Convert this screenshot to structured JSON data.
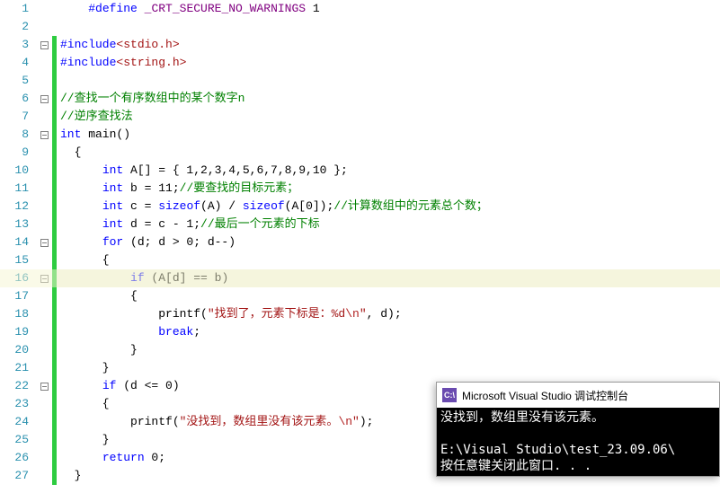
{
  "lines": [
    {
      "n": 1,
      "fold": "",
      "cb": "",
      "seg": [
        [
          "",
          "    "
        ],
        [
          "kw-blue",
          "#define"
        ],
        [
          "",
          " "
        ],
        [
          "kw-purple",
          "_CRT_SECURE_NO_WARNINGS"
        ],
        [
          "",
          " 1"
        ]
      ]
    },
    {
      "n": 2,
      "fold": "",
      "cb": "",
      "seg": []
    },
    {
      "n": 3,
      "fold": "−",
      "cb": "g",
      "seg": [
        [
          "kw-blue",
          "#include"
        ],
        [
          "str",
          "<stdio.h>"
        ]
      ]
    },
    {
      "n": 4,
      "fold": "",
      "cb": "g",
      "seg": [
        [
          "kw-blue",
          "#include"
        ],
        [
          "str",
          "<string.h>"
        ]
      ]
    },
    {
      "n": 5,
      "fold": "",
      "cb": "g",
      "seg": []
    },
    {
      "n": 6,
      "fold": "−",
      "cb": "g",
      "seg": [
        [
          "comment",
          "//查找一个有序数组中的某个数字n"
        ]
      ]
    },
    {
      "n": 7,
      "fold": "",
      "cb": "g",
      "seg": [
        [
          "comment",
          "//逆序查找法"
        ]
      ]
    },
    {
      "n": 8,
      "fold": "−",
      "cb": "g",
      "seg": [
        [
          "kw-blue",
          "int"
        ],
        [
          "",
          " main()"
        ]
      ]
    },
    {
      "n": 9,
      "fold": "",
      "cb": "g",
      "seg": [
        [
          "",
          "  {"
        ]
      ]
    },
    {
      "n": 10,
      "fold": "",
      "cb": "g",
      "seg": [
        [
          "",
          "      "
        ],
        [
          "kw-blue",
          "int"
        ],
        [
          "",
          " A[] = { 1,2,3,4,5,6,7,8,9,10 };"
        ]
      ]
    },
    {
      "n": 11,
      "fold": "",
      "cb": "g",
      "seg": [
        [
          "",
          "      "
        ],
        [
          "kw-blue",
          "int"
        ],
        [
          "",
          " b = 11;"
        ],
        [
          "comment",
          "//要查找的目标元素；"
        ]
      ]
    },
    {
      "n": 12,
      "fold": "",
      "cb": "g",
      "seg": [
        [
          "",
          "      "
        ],
        [
          "kw-blue",
          "int"
        ],
        [
          "",
          " c = "
        ],
        [
          "kw-blue",
          "sizeof"
        ],
        [
          "",
          "(A) / "
        ],
        [
          "kw-blue",
          "sizeof"
        ],
        [
          "",
          "(A[0]);"
        ],
        [
          "comment",
          "//计算数组中的元素总个数；"
        ]
      ]
    },
    {
      "n": 13,
      "fold": "",
      "cb": "g",
      "seg": [
        [
          "",
          "      "
        ],
        [
          "kw-blue",
          "int"
        ],
        [
          "",
          " d = c - 1;"
        ],
        [
          "comment",
          "//最后一个元素的下标"
        ]
      ]
    },
    {
      "n": 14,
      "fold": "−",
      "cb": "g",
      "seg": [
        [
          "",
          "      "
        ],
        [
          "kw-blue",
          "for"
        ],
        [
          "",
          " (d; d > 0; d--)"
        ]
      ]
    },
    {
      "n": 15,
      "fold": "",
      "cb": "g",
      "seg": [
        [
          "",
          "      {"
        ]
      ]
    },
    {
      "n": 16,
      "fold": "−",
      "cb": "g",
      "hl": true,
      "seg": [
        [
          "",
          "          "
        ],
        [
          "kw-blue",
          "if"
        ],
        [
          "",
          " (A[d] == b)"
        ]
      ]
    },
    {
      "n": 17,
      "fold": "",
      "cb": "g",
      "seg": [
        [
          "",
          "          {"
        ]
      ]
    },
    {
      "n": 18,
      "fold": "",
      "cb": "g",
      "seg": [
        [
          "",
          "              printf("
        ],
        [
          "str",
          "\"找到了，元素下标是：%d"
        ],
        [
          "esc",
          "\\n"
        ],
        [
          "str",
          "\""
        ],
        [
          "",
          ", d);"
        ]
      ]
    },
    {
      "n": 19,
      "fold": "",
      "cb": "g",
      "seg": [
        [
          "",
          "              "
        ],
        [
          "kw-blue",
          "break"
        ],
        [
          "",
          ";"
        ]
      ]
    },
    {
      "n": 20,
      "fold": "",
      "cb": "g",
      "seg": [
        [
          "",
          "          }"
        ]
      ]
    },
    {
      "n": 21,
      "fold": "",
      "cb": "g",
      "seg": [
        [
          "",
          "      }"
        ]
      ]
    },
    {
      "n": 22,
      "fold": "−",
      "cb": "g",
      "seg": [
        [
          "",
          "      "
        ],
        [
          "kw-blue",
          "if"
        ],
        [
          "",
          " (d <= 0)"
        ]
      ]
    },
    {
      "n": 23,
      "fold": "",
      "cb": "g",
      "seg": [
        [
          "",
          "      {"
        ]
      ]
    },
    {
      "n": 24,
      "fold": "",
      "cb": "g",
      "seg": [
        [
          "",
          "          printf("
        ],
        [
          "str",
          "\"没找到，数组里没有该元素。"
        ],
        [
          "esc",
          "\\n"
        ],
        [
          "str",
          "\""
        ],
        [
          "",
          ");"
        ]
      ]
    },
    {
      "n": 25,
      "fold": "",
      "cb": "g",
      "seg": [
        [
          "",
          "      }"
        ]
      ]
    },
    {
      "n": 26,
      "fold": "",
      "cb": "g",
      "seg": [
        [
          "",
          "      "
        ],
        [
          "kw-blue",
          "return"
        ],
        [
          "",
          " 0;"
        ]
      ]
    },
    {
      "n": 27,
      "fold": "",
      "cb": "g",
      "seg": [
        [
          "",
          "  }"
        ]
      ]
    }
  ],
  "console": {
    "icon": "C:\\",
    "title": "Microsoft Visual Studio 调试控制台",
    "body": "没找到，数组里没有该元素。\n\nE:\\Visual Studio\\test_23.09.06\\\n按任意键关闭此窗口. . ."
  }
}
